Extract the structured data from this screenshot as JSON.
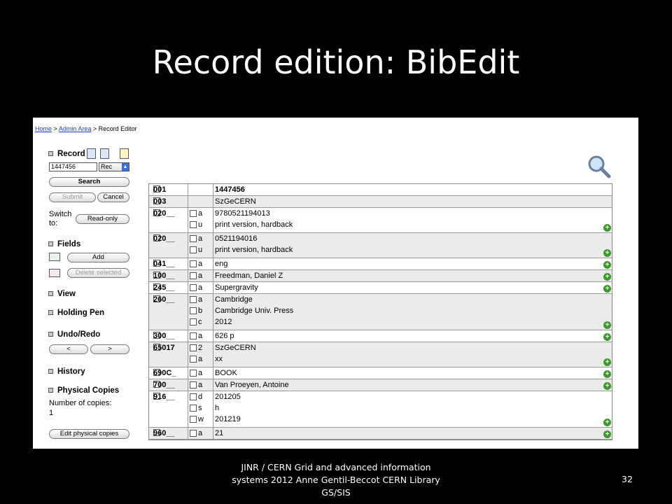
{
  "slide": {
    "title": "Record edition: BibEdit",
    "footer": "JINR / CERN Grid and advanced information systems 2012 Anne Gentil-Beccot CERN Library GS/SIS",
    "page_number": "32"
  },
  "breadcrumb": {
    "home": "Home",
    "admin": "Admin Area",
    "current": "Record Editor",
    "sep": ">"
  },
  "sidebar": {
    "record_heading": "Record",
    "record_id_value": "1447456",
    "rec_select": "Rec",
    "search_button": "Search",
    "submit_button": "Submit",
    "cancel_button": "Cancel",
    "switch_label": "Switch to:",
    "readonly_button": "Read-only",
    "fields_heading": "Fields",
    "add_button": "Add",
    "delete_button": "Delete selected",
    "view_heading": "View",
    "holding_pen_heading": "Holding Pen",
    "undo_redo_heading": "Undo/Redo",
    "undo_button": "<",
    "redo_button": ">",
    "history_heading": "History",
    "physical_copies_heading": "Physical Copies",
    "copies_label": "Number of copies:",
    "copies_value": "1",
    "edit_copies_button": "Edit physical copies"
  },
  "fields": [
    {
      "tag": "001",
      "subfields": [
        {
          "code": "",
          "value": "1447456",
          "bold": true
        }
      ],
      "plus": false
    },
    {
      "tag": "003",
      "subfields": [
        {
          "code": "",
          "value": "SzGeCERN"
        }
      ],
      "plus": false
    },
    {
      "tag": "020__",
      "subfields": [
        {
          "code": "a",
          "value": "9780521194013"
        },
        {
          "code": "u",
          "value": "print version, hardback"
        }
      ],
      "plus": true
    },
    {
      "tag": "020__",
      "subfields": [
        {
          "code": "a",
          "value": "0521194016"
        },
        {
          "code": "u",
          "value": "print version, hardback"
        }
      ],
      "plus": true
    },
    {
      "tag": "041__",
      "subfields": [
        {
          "code": "a",
          "value": "eng"
        }
      ],
      "plus": true
    },
    {
      "tag": "100__",
      "subfields": [
        {
          "code": "a",
          "value": "Freedman, Daniel Z"
        }
      ],
      "plus": true
    },
    {
      "tag": "245__",
      "subfields": [
        {
          "code": "a",
          "value": "Supergravity"
        }
      ],
      "plus": true
    },
    {
      "tag": "260__",
      "subfields": [
        {
          "code": "a",
          "value": "Cambridge"
        },
        {
          "code": "b",
          "value": "Cambridge Univ. Press"
        },
        {
          "code": "c",
          "value": "2012"
        }
      ],
      "plus": true
    },
    {
      "tag": "300__",
      "subfields": [
        {
          "code": "a",
          "value": "626 p"
        }
      ],
      "plus": true
    },
    {
      "tag": "65017",
      "subfields": [
        {
          "code": "2",
          "value": "SzGeCERN"
        },
        {
          "code": "a",
          "value": "xx"
        }
      ],
      "plus": true
    },
    {
      "tag": "690C_",
      "subfields": [
        {
          "code": "a",
          "value": "BOOK"
        }
      ],
      "plus": true
    },
    {
      "tag": "700__",
      "subfields": [
        {
          "code": "a",
          "value": "Van Proeyen, Antoine"
        }
      ],
      "plus": true
    },
    {
      "tag": "916__",
      "subfields": [
        {
          "code": "d",
          "value": "201205"
        },
        {
          "code": "s",
          "value": "h"
        },
        {
          "code": "w",
          "value": "201219"
        }
      ],
      "plus": true
    },
    {
      "tag": "960__",
      "subfields": [
        {
          "code": "a",
          "value": "21"
        }
      ],
      "plus": true
    }
  ]
}
